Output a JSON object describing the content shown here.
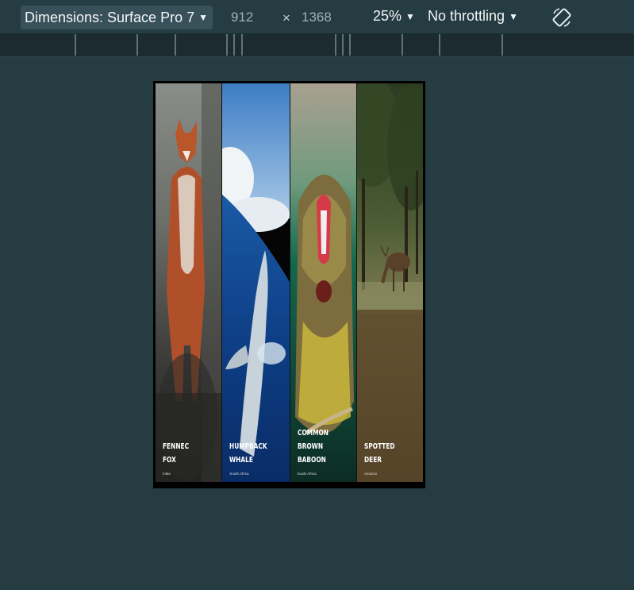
{
  "toolbar": {
    "device_label": "Dimensions: Surface Pro 7",
    "width_value": "912",
    "height_value": "1368",
    "separator": "×",
    "zoom_label": "25%",
    "throttle_label": "No throttling",
    "rotate_icon": "rotate-icon"
  },
  "panels": [
    {
      "name": "Fennec Fox",
      "name_lines": "FENNEC\nFOX",
      "location": "India"
    },
    {
      "name": "Humpback Whale",
      "name_lines": "HUMPBACK\nWHALE",
      "location": "South Africa"
    },
    {
      "name": "Common Brown Baboon",
      "name_lines": "COMMON\nBROWN\nBABOON",
      "location": "South Africa"
    },
    {
      "name": "Spotted Deer",
      "name_lines": "SPOTTED\nDEER",
      "location": "Amazon"
    }
  ],
  "colors": {
    "background": "#253c42",
    "ruler": "#1b2b30",
    "device_select": "#37505a"
  }
}
